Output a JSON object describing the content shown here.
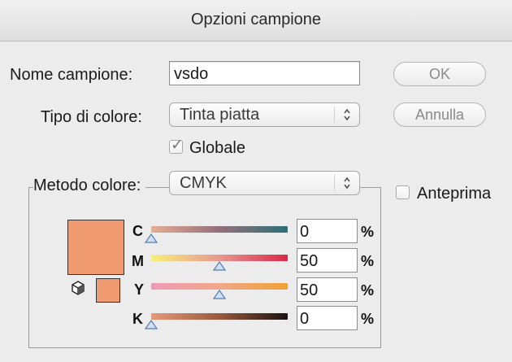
{
  "window": {
    "title": "Opzioni campione"
  },
  "name": {
    "label": "Nome campione:",
    "value": "vsdo"
  },
  "color_type": {
    "label": "Tipo di colore:",
    "value": "Tinta piatta"
  },
  "global": {
    "label": "Globale",
    "checked": true
  },
  "color_mode": {
    "label": "Metodo colore:",
    "value": "CMYK"
  },
  "buttons": {
    "ok": "OK",
    "cancel": "Annulla"
  },
  "preview": {
    "label": "Anteprima",
    "checked": false
  },
  "swatch_color": "#f09b72",
  "channels": [
    {
      "letter": "C",
      "value": "0",
      "unit": "%",
      "fraction": 0.0
    },
    {
      "letter": "M",
      "value": "50",
      "unit": "%",
      "fraction": 0.5
    },
    {
      "letter": "Y",
      "value": "50",
      "unit": "%",
      "fraction": 0.5
    },
    {
      "letter": "K",
      "value": "0",
      "unit": "%",
      "fraction": 0.0
    }
  ]
}
